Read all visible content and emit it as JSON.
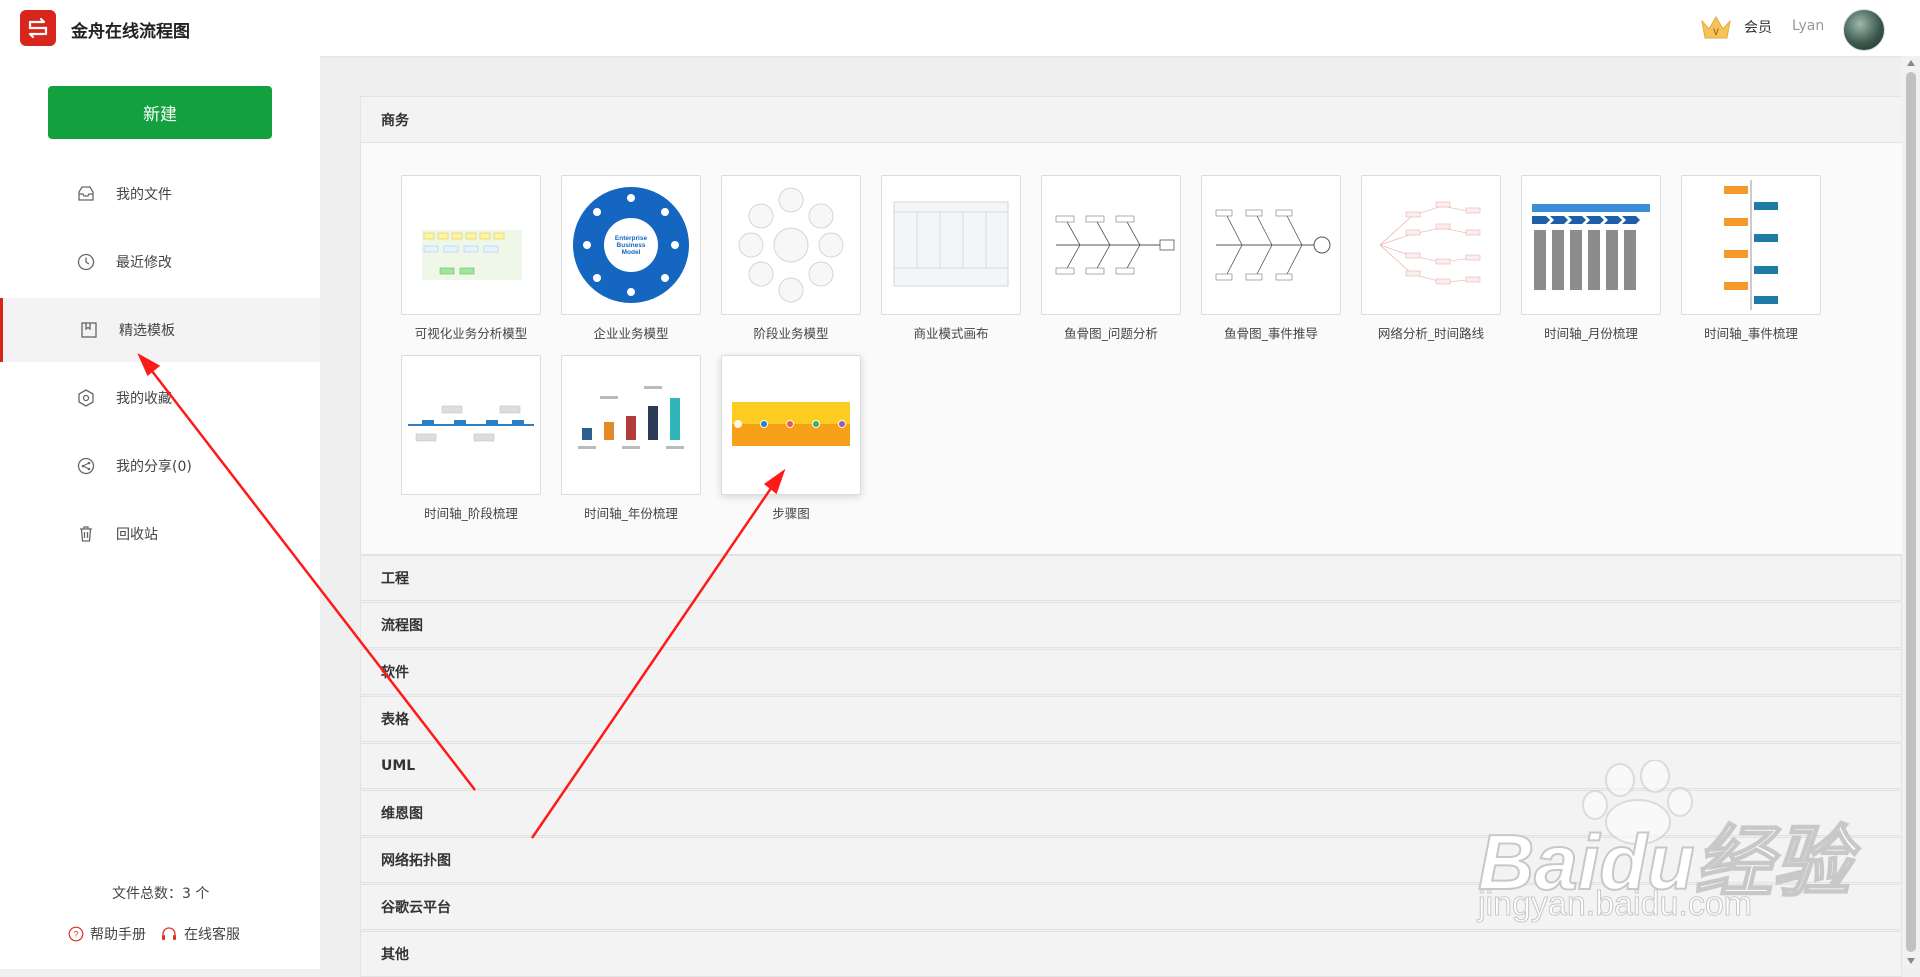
{
  "header": {
    "app_title": "金舟在线流程图",
    "vip_label": "会员",
    "username": "Lyan",
    "icons": {
      "logo": "flow-logo-icon",
      "vip": "crown-icon",
      "avatar": "avatar-image"
    }
  },
  "sidebar": {
    "new_button": "新建",
    "items": [
      {
        "label": "我的文件",
        "icon": "inbox-icon",
        "active": false
      },
      {
        "label": "最近修改",
        "icon": "clock-icon",
        "active": false
      },
      {
        "label": "精选模板",
        "icon": "bookmark-icon",
        "active": true
      },
      {
        "label": "我的收藏",
        "icon": "star-hex-icon",
        "active": false
      },
      {
        "label": "我的分享(0)",
        "icon": "share-icon",
        "active": false
      },
      {
        "label": "回收站",
        "icon": "trash-icon",
        "active": false
      }
    ],
    "file_count": "文件总数：3 个",
    "help": "帮助手册",
    "service": "在线客服"
  },
  "main": {
    "expanded_category": "商务",
    "templates": [
      {
        "label": "可视化业务分析模型",
        "thumb": "business-analysis"
      },
      {
        "label": "企业业务模型",
        "thumb": "enterprise-circle"
      },
      {
        "label": "阶段业务模型",
        "thumb": "stage-circle"
      },
      {
        "label": "商业模式画布",
        "thumb": "canvas"
      },
      {
        "label": "鱼骨图_问题分析",
        "thumb": "fishbone-1"
      },
      {
        "label": "鱼骨图_事件推导",
        "thumb": "fishbone-2"
      },
      {
        "label": "网络分析_时间路线",
        "thumb": "network"
      },
      {
        "label": "时间轴_月份梳理",
        "thumb": "timeline-month"
      },
      {
        "label": "时间轴_事件梳理",
        "thumb": "timeline-event"
      },
      {
        "label": "时间轴_阶段梳理",
        "thumb": "timeline-stage"
      },
      {
        "label": "时间轴_年份梳理",
        "thumb": "timeline-year"
      },
      {
        "label": "步骤图",
        "thumb": "steps"
      }
    ],
    "collapsed_categories": [
      "工程",
      "流程图",
      "软件",
      "表格",
      "UML",
      "维恩图",
      "网络拓扑图",
      "谷歌云平台",
      "其他"
    ]
  },
  "watermark": {
    "line1": "Baidu经验",
    "line2": "jingyan.baidu.com"
  },
  "colors": {
    "brand_red": "#d9261c",
    "new_green": "#13a13f",
    "arrow_red": "#ff1a1a"
  }
}
